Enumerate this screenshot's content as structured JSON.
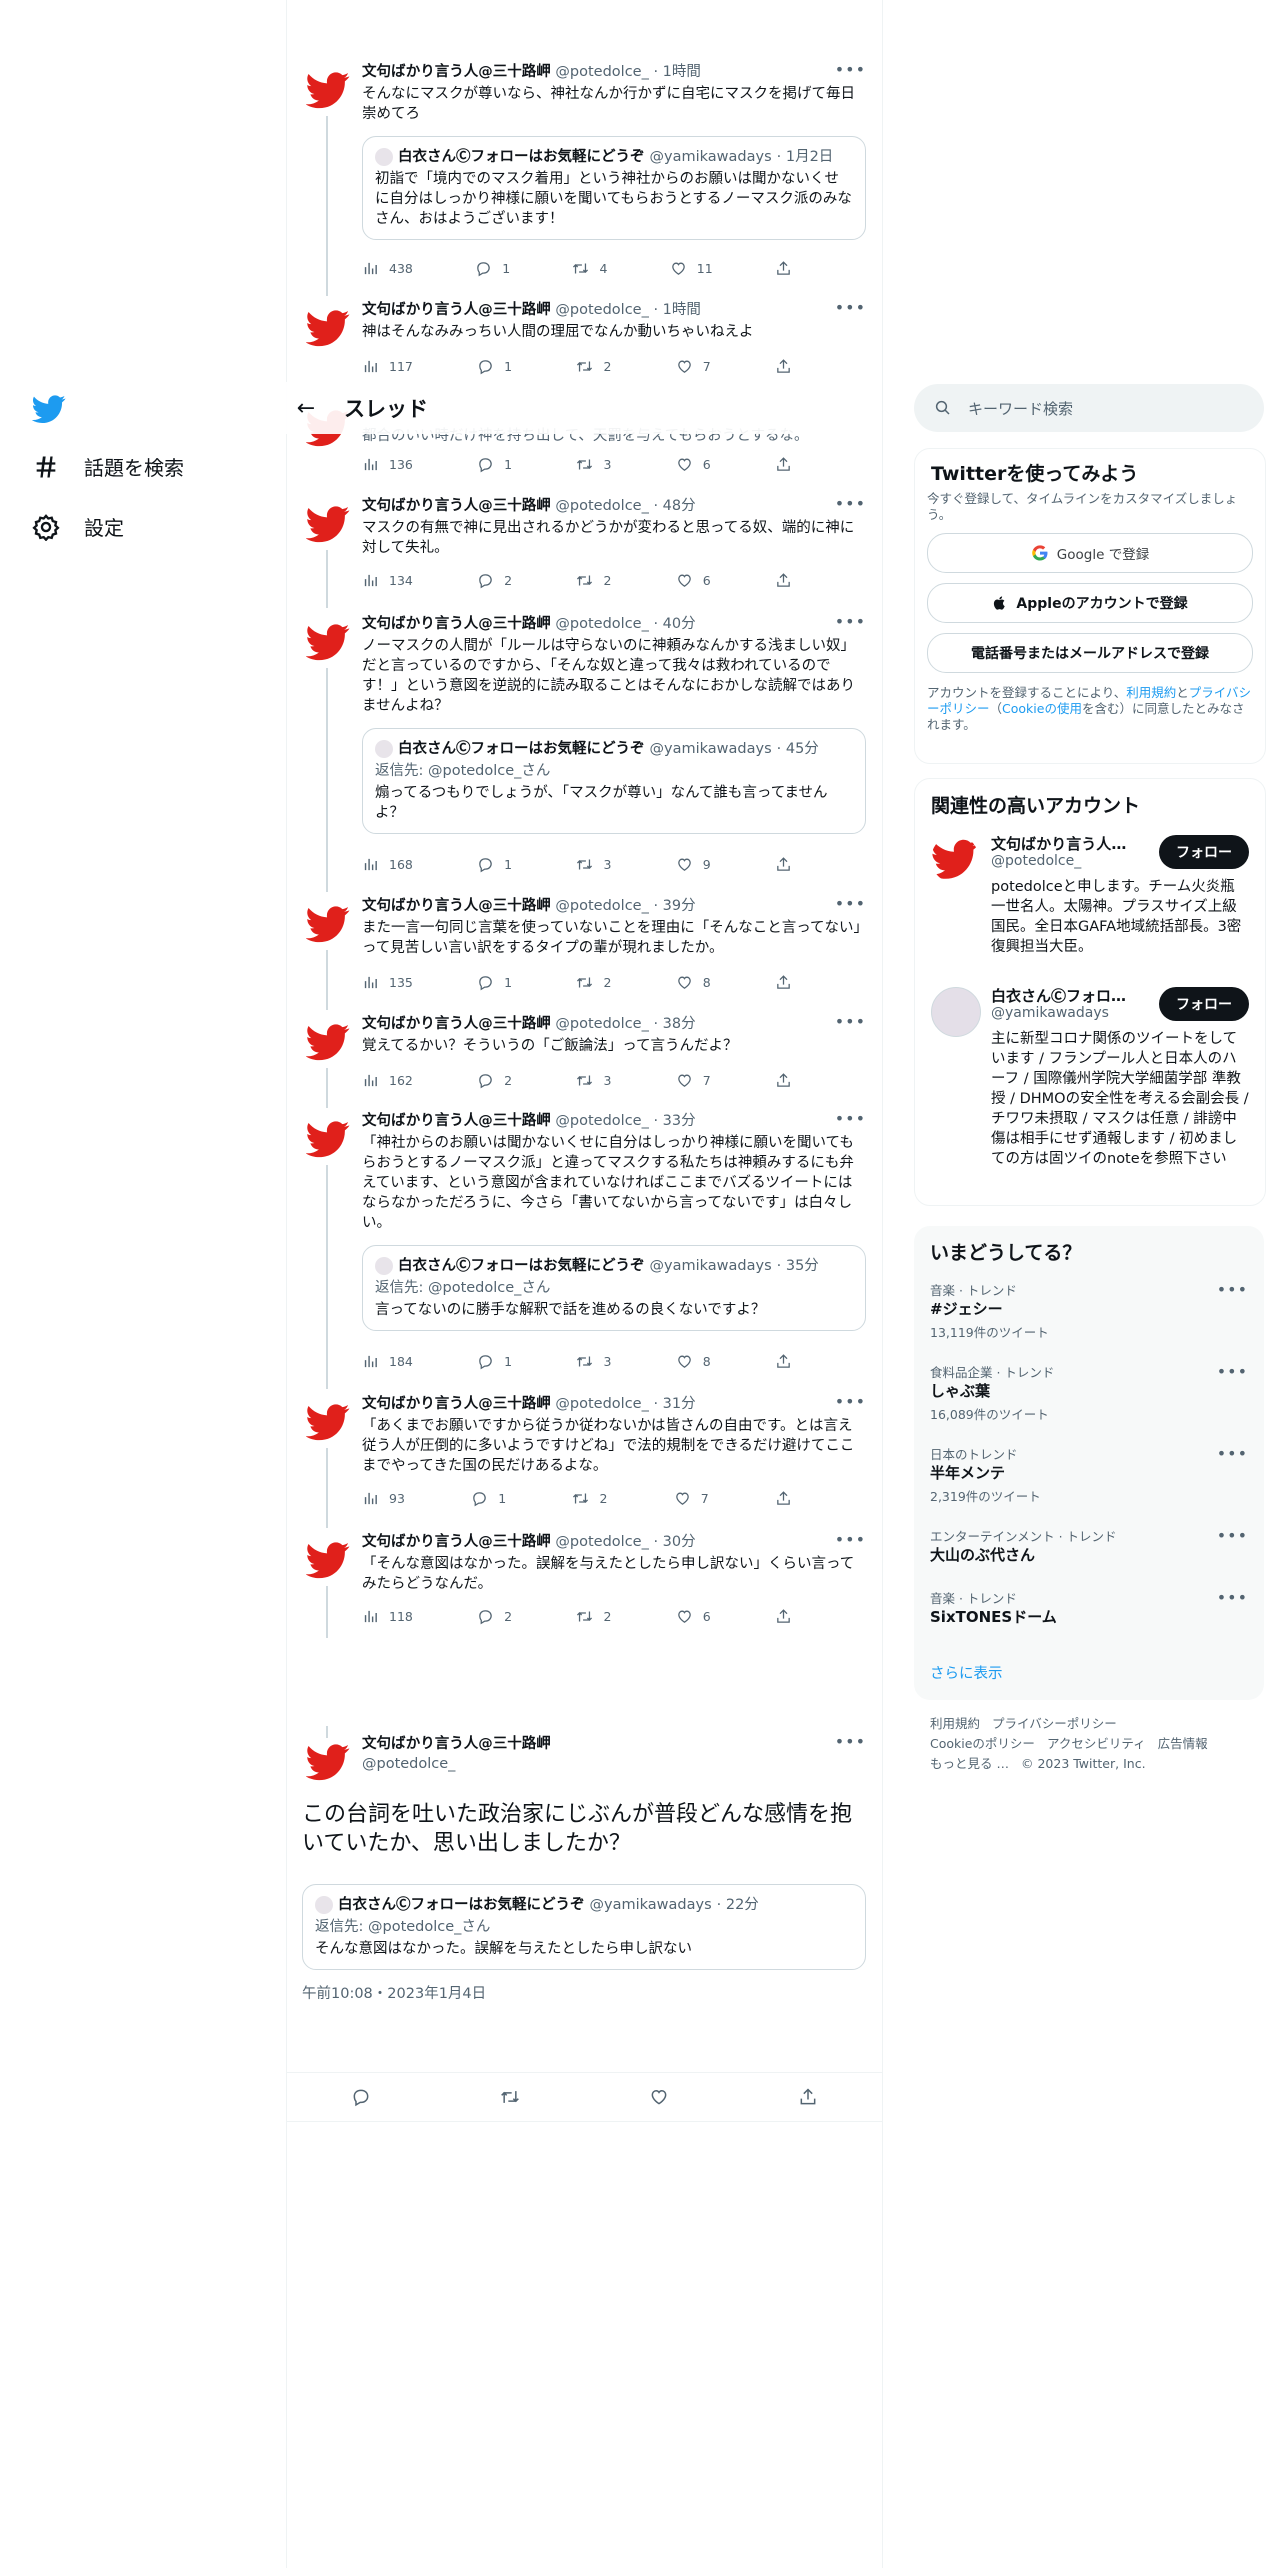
{
  "nav": {
    "explore_label": "話題を検索",
    "settings_label": "設定"
  },
  "header": {
    "title": "スレッド"
  },
  "search": {
    "placeholder": "キーワード検索"
  },
  "tweets": [
    {
      "name": "文句ばかり言う人@三十路岬",
      "handle": "@potedolce_",
      "time": "· 1時間",
      "text": "そんなにマスクが尊いなら、神社なんか行かずに自宅にマスクを掲げて毎日崇めてろ",
      "quote": {
        "name": "白衣さんⒸフォローはお気軽にどうぞ",
        "handle": "@yamikawadays",
        "time": "· 1月2日",
        "reply_to": "",
        "text": "初詣で「境内でのマスク着用」という神社からのお願いは聞かないくせに自分はしっかり神様に願いを聞いてもらおうとするノーマスク派のみなさん、おはようございます！"
      },
      "stats": {
        "views": "438",
        "replies": "1",
        "retweets": "4",
        "likes": "11"
      }
    },
    {
      "name": "文句ばかり言う人@三十路岬",
      "handle": "@potedolce_",
      "time": "· 1時間",
      "text": "神はそんなみみっちい人間の理屈でなんか動いちゃいねえよ",
      "stats": {
        "views": "117",
        "replies": "1",
        "retweets": "2",
        "likes": "7"
      }
    },
    {
      "partial_text": "都合のいい時だけ神を持ち出して、天罰を与えてもらおうとするな。",
      "stats": {
        "views": "136",
        "replies": "1",
        "retweets": "3",
        "likes": "6"
      }
    },
    {
      "name": "文句ばかり言う人@三十路岬",
      "handle": "@potedolce_",
      "time": "· 48分",
      "text": "マスクの有無で神に見出されるかどうかが変わると思ってる奴、端的に神に対して失礼。",
      "stats": {
        "views": "134",
        "replies": "2",
        "retweets": "2",
        "likes": "6"
      }
    },
    {
      "name": "文句ばかり言う人@三十路岬",
      "handle": "@potedolce_",
      "time": "· 40分",
      "text": "ノーマスクの人間が「ルールは守らないのに神頼みなんかする浅ましい奴」だと言っているのですから、「そんな奴と違って我々は救われているのです！」という意図を逆説的に読み取ることはそんなにおかしな読解ではありませんよね？",
      "quote": {
        "name": "白衣さんⒸフォローはお気軽にどうぞ",
        "handle": "@yamikawadays",
        "time": "· 45分",
        "reply_to": "返信先: @potedolce_さん",
        "text": "煽ってるつもりでしょうが、「マスクが尊い」なんて誰も言ってませんよ？"
      },
      "stats": {
        "views": "168",
        "replies": "1",
        "retweets": "3",
        "likes": "9"
      }
    },
    {
      "name": "文句ばかり言う人@三十路岬",
      "handle": "@potedolce_",
      "time": "· 39分",
      "text": "また一言一句同じ言葉を使っていないことを理由に「そんなこと言ってない」って見苦しい言い訳をするタイプの輩が現れましたか。",
      "stats": {
        "views": "135",
        "replies": "1",
        "retweets": "2",
        "likes": "8"
      }
    },
    {
      "name": "文句ばかり言う人@三十路岬",
      "handle": "@potedolce_",
      "time": "· 38分",
      "text": "覚えてるかい？そういうの「ご飯論法」って言うんだよ？",
      "stats": {
        "views": "162",
        "replies": "2",
        "retweets": "3",
        "likes": "7"
      }
    },
    {
      "name": "文句ばかり言う人@三十路岬",
      "handle": "@potedolce_",
      "time": "· 33分",
      "text": "「神社からのお願いは聞かないくせに自分はしっかり神様に願いを聞いてもらおうとするノーマスク派」と違ってマスクする私たちは神頼みするにも弁えています、という意図が含まれていなければここまでバズるツイートにはならなかっただろうに、今さら「書いてないから言ってないです」は白々しい。",
      "quote": {
        "name": "白衣さんⒸフォローはお気軽にどうぞ",
        "handle": "@yamikawadays",
        "time": "· 35分",
        "reply_to": "返信先: @potedolce_さん",
        "text": "言ってないのに勝手な解釈で話を進めるの良くないですよ？"
      },
      "stats": {
        "views": "184",
        "replies": "1",
        "retweets": "3",
        "likes": "8"
      }
    },
    {
      "name": "文句ばかり言う人@三十路岬",
      "handle": "@potedolce_",
      "time": "· 31分",
      "text": "「あくまでお願いですから従うか従わないかは皆さんの自由です。とは言え従う人が圧倒的に多いようですけどね」で法的規制をできるだけ避けてここまでやってきた国の民だけあるよな。",
      "stats": {
        "views": "93",
        "replies": "1",
        "retweets": "2",
        "likes": "7"
      }
    },
    {
      "name": "文句ばかり言う人@三十路岬",
      "handle": "@potedolce_",
      "time": "· 30分",
      "text": "「そんな意図はなかった。誤解を与えたとしたら申し訳ない」くらい言ってみたらどうなんだ。",
      "stats": {
        "views": "118",
        "replies": "2",
        "retweets": "2",
        "likes": "6"
      }
    }
  ],
  "main_tweet": {
    "name": "文句ばかり言う人@三十路岬",
    "handle": "@potedolce_",
    "text": "この台詞を吐いた政治家にじぶんが普段どんな感情を抱いていたか、思い出しましたか？",
    "quote": {
      "name": "白衣さんⒸフォローはお気軽にどうぞ",
      "handle": "@yamikawadays",
      "time": "· 22分",
      "reply_to": "返信先: @potedolce_さん",
      "text": "そんな意図はなかった。誤解を与えたとしたら申し訳ない"
    },
    "timestamp": "午前10:08・2023年1月4日"
  },
  "signup": {
    "title": "Twitterを使ってみよう",
    "subtitle": "今すぐ登録して、タイムラインをカスタマイズしましょう。",
    "google_button": "Google で登録",
    "apple_button": "Appleのアカウントで登録",
    "phone_button": "電話番号またはメールアドレスで登録",
    "terms_prefix": "アカウントを登録することにより、",
    "terms_link1": "利用規約",
    "terms_mid": "と",
    "terms_link2": "プライバシーポリシー",
    "terms_paren_open": "（",
    "terms_link3": "Cookieの使用",
    "terms_suffix": "を含む）に同意したとみなされます。"
  },
  "related": {
    "title": "関連性の高いアカウント",
    "follow_label": "フォロー",
    "accounts": [
      {
        "name": "文句ばかり言う人@三十路岬",
        "handle": "@potedolce_",
        "bio": "potedolceと申します。チーム火炎瓶一世名人。太陽神。プラスサイズ上級国民。全日本GAFA地域統括部長。3密復興担当大臣。"
      },
      {
        "name": "白衣さんⒸフォローはお気軽にどうぞ",
        "handle": "@yamikawadays",
        "bio": "主に新型コロナ関係のツイートをしています / フランプール人と日本人のハーフ / 国際儀州学院大学細菌学部 準教授 / DHMOの安全性を考える会副会長 / チワワ未摂取 / マスクは任意 / 誹謗中傷は相手にせず通報します / 初めましての方は固ツイのnoteを参照下さい"
      }
    ]
  },
  "trends": {
    "title": "いまどうしてる？",
    "items": [
      {
        "context": "音楽 · トレンド",
        "name": "#ジェシー",
        "count": "13,119件のツイート"
      },
      {
        "context": "食料品企業 · トレンド",
        "name": "しゃぶ葉",
        "count": "16,089件のツイート"
      },
      {
        "context": "日本のトレンド",
        "name": "半年メンテ",
        "count": "2,319件のツイート"
      },
      {
        "context": "エンターテインメント · トレンド",
        "name": "大山のぶ代さん",
        "count": ""
      },
      {
        "context": "音楽 · トレンド",
        "name": "SixTONESドーム",
        "count": ""
      }
    ],
    "show_more": "さらに表示"
  },
  "footer": {
    "terms": "利用規約",
    "privacy": "プライバシーポリシー",
    "cookie": "Cookieのポリシー",
    "accessibility": "アクセシビリティ",
    "ads": "広告情報",
    "more": "もっと見る …",
    "copyright": "© 2023 Twitter, Inc."
  },
  "colors": {
    "accent": "#1d9bf0",
    "bird_red": "#e0201b",
    "text": "#0f1419",
    "muted": "#536471"
  }
}
